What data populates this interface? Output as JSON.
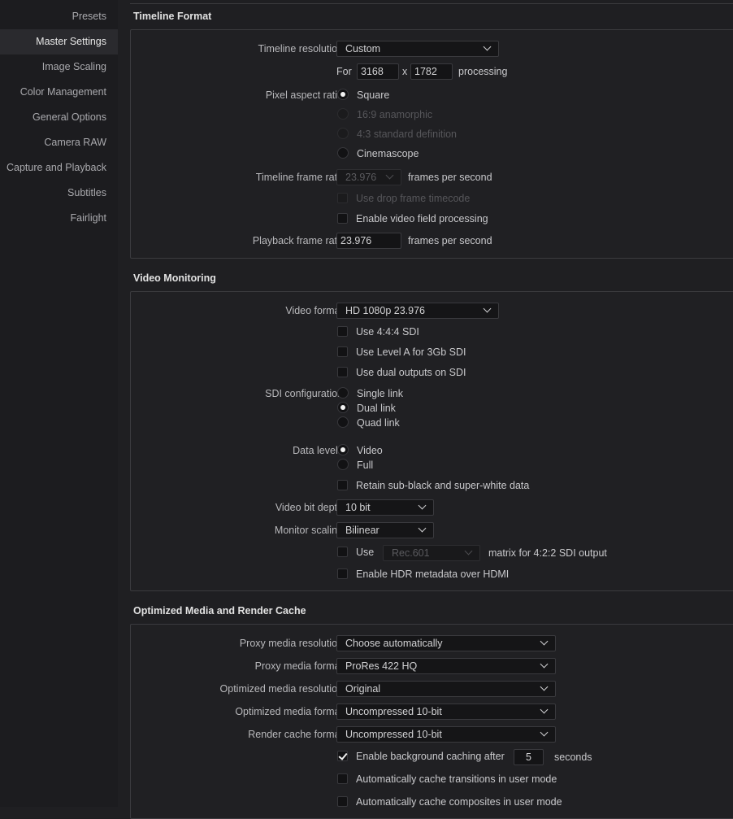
{
  "sidebar": {
    "items": [
      {
        "label": "Presets",
        "active": false
      },
      {
        "label": "Master Settings",
        "active": true
      },
      {
        "label": "Image Scaling",
        "active": false
      },
      {
        "label": "Color Management",
        "active": false
      },
      {
        "label": "General Options",
        "active": false
      },
      {
        "label": "Camera RAW",
        "active": false
      },
      {
        "label": "Capture and Playback",
        "active": false
      },
      {
        "label": "Subtitles",
        "active": false
      },
      {
        "label": "Fairlight",
        "active": false
      }
    ]
  },
  "timeline_format": {
    "title": "Timeline Format",
    "resolution_label": "Timeline resolution",
    "resolution_value": "Custom",
    "for_label": "For",
    "width": "3168",
    "x_label": "x",
    "height": "1782",
    "processing_label": "processing",
    "par_label": "Pixel aspect ratio",
    "par_options": [
      {
        "label": "Square",
        "selected": true,
        "disabled": false
      },
      {
        "label": "16:9 anamorphic",
        "selected": false,
        "disabled": true
      },
      {
        "label": "4:3 standard definition",
        "selected": false,
        "disabled": true
      },
      {
        "label": "Cinemascope",
        "selected": false,
        "disabled": false
      }
    ],
    "frame_rate_label": "Timeline frame rate",
    "frame_rate_value": "23.976",
    "fps_unit": "frames per second",
    "drop_frame_label": "Use drop frame timecode",
    "field_processing_label": "Enable video field processing",
    "playback_rate_label": "Playback frame rate",
    "playback_rate_value": "23.976",
    "playback_fps_unit": "frames per second"
  },
  "video_monitoring": {
    "title": "Video Monitoring",
    "video_format_label": "Video format",
    "video_format_value": "HD 1080p 23.976",
    "use_444_label": "Use 4:4:4 SDI",
    "level_a_label": "Use Level A for 3Gb SDI",
    "dual_outputs_label": "Use dual outputs on SDI",
    "sdi_label": "SDI configuration",
    "sdi_options": [
      {
        "label": "Single link",
        "selected": false
      },
      {
        "label": "Dual link",
        "selected": true
      },
      {
        "label": "Quad link",
        "selected": false
      }
    ],
    "data_levels_label": "Data levels",
    "data_levels_options": [
      {
        "label": "Video",
        "selected": true
      },
      {
        "label": "Full",
        "selected": false
      }
    ],
    "retain_label": "Retain sub-black and super-white data",
    "bit_depth_label": "Video bit depth",
    "bit_depth_value": "10 bit",
    "monitor_scaling_label": "Monitor scaling",
    "monitor_scaling_value": "Bilinear",
    "use_label": "Use",
    "matrix_value": "Rec.601",
    "matrix_suffix": "matrix for 4:2:2 SDI output",
    "hdr_label": "Enable HDR metadata over HDMI"
  },
  "optimized_media": {
    "title": "Optimized Media and Render Cache",
    "proxy_res_label": "Proxy media resolution",
    "proxy_res_value": "Choose automatically",
    "proxy_format_label": "Proxy media format",
    "proxy_format_value": "ProRes 422 HQ",
    "opt_res_label": "Optimized media resolution",
    "opt_res_value": "Original",
    "opt_format_label": "Optimized media format",
    "opt_format_value": "Uncompressed 10-bit",
    "render_format_label": "Render cache format",
    "render_format_value": "Uncompressed 10-bit",
    "bg_cache_label": "Enable background caching after",
    "bg_cache_seconds": "5",
    "seconds_label": "seconds",
    "cache_transitions_label": "Automatically cache transitions in user mode",
    "cache_composites_label": "Automatically cache composites in user mode"
  }
}
